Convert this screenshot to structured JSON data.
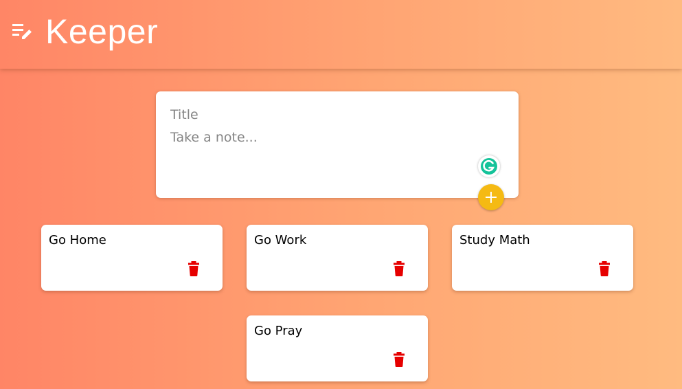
{
  "header": {
    "title": "Keeper",
    "logo_icon": "notes-edit-icon"
  },
  "create_form": {
    "title_placeholder": "Title",
    "content_placeholder": "Take a note...",
    "add_icon": "plus-icon",
    "grammarly_icon": "grammarly-icon"
  },
  "notes": [
    {
      "title": "Go Home"
    },
    {
      "title": "Go Work"
    },
    {
      "title": "Study Math"
    },
    {
      "title": "Go Pray"
    }
  ],
  "colors": {
    "accent": "#f5ba13",
    "delete": "#e60000",
    "grammarly": "#15c39a"
  }
}
